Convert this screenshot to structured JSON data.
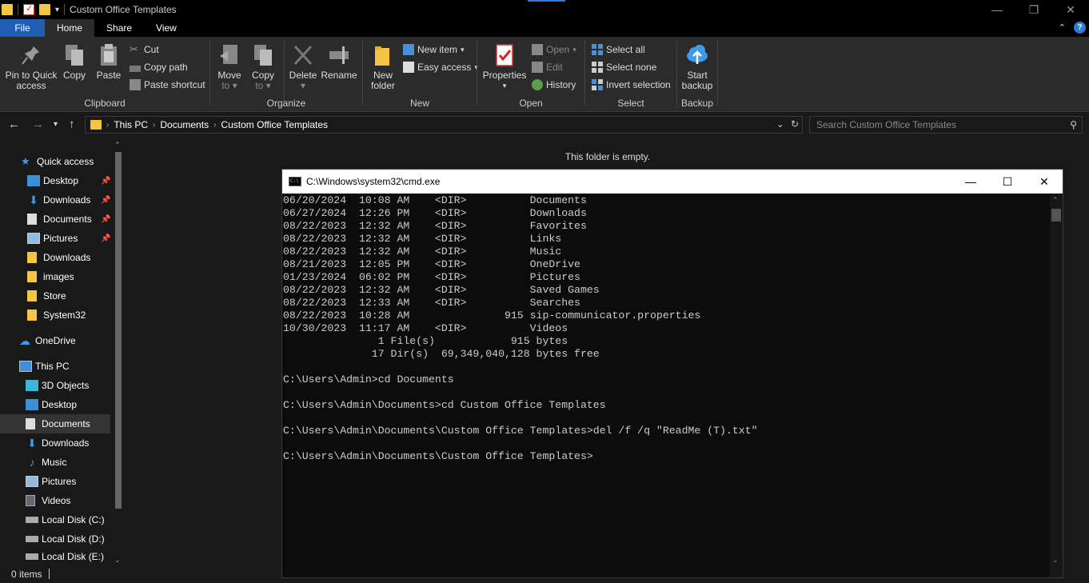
{
  "window": {
    "title": "Custom Office Templates"
  },
  "ribbon_tabs": [
    {
      "label": "File"
    },
    {
      "label": "Home"
    },
    {
      "label": "Share"
    },
    {
      "label": "View"
    }
  ],
  "ribbon": {
    "clipboard": {
      "label": "Clipboard",
      "pin": "Pin to Quick access",
      "pin_line1": "Pin to Quick",
      "pin_line2": "access",
      "copy": "Copy",
      "paste": "Paste",
      "cut": "Cut",
      "copy_path": "Copy path",
      "paste_shortcut": "Paste shortcut"
    },
    "organize": {
      "label": "Organize",
      "move_line1": "Move",
      "move_line2": "to",
      "copy_line1": "Copy",
      "copy_line2": "to",
      "delete": "Delete",
      "rename": "Rename"
    },
    "new": {
      "label": "New",
      "new_folder_line1": "New",
      "new_folder_line2": "folder",
      "new_item": "New item",
      "easy_access": "Easy access"
    },
    "open": {
      "label": "Open",
      "properties": "Properties",
      "open": "Open",
      "edit": "Edit",
      "history": "History"
    },
    "select": {
      "label": "Select",
      "select_all": "Select all",
      "select_none": "Select none",
      "invert": "Invert selection"
    },
    "backup": {
      "label": "Backup",
      "start_line1": "Start",
      "start_line2": "backup"
    }
  },
  "address": {
    "crumbs": [
      "This PC",
      "Documents",
      "Custom Office Templates"
    ],
    "search_placeholder": "Search Custom Office Templates"
  },
  "nav": {
    "quick_access": "Quick access",
    "quick_items": [
      {
        "label": "Desktop",
        "pinned": true,
        "icon": "desktop-icon"
      },
      {
        "label": "Downloads",
        "pinned": true,
        "icon": "downloads-icon"
      },
      {
        "label": "Documents",
        "pinned": true,
        "icon": "documents-icon"
      },
      {
        "label": "Pictures",
        "pinned": true,
        "icon": "pictures-icon"
      },
      {
        "label": "Downloads",
        "pinned": false,
        "icon": "folder-icon"
      },
      {
        "label": "images",
        "pinned": false,
        "icon": "folder-icon"
      },
      {
        "label": "Store",
        "pinned": false,
        "icon": "folder-icon"
      },
      {
        "label": "System32",
        "pinned": false,
        "icon": "folder-icon"
      }
    ],
    "onedrive": "OneDrive",
    "this_pc": "This PC",
    "pc_items": [
      {
        "label": "3D Objects",
        "icon": "3d-objects-icon"
      },
      {
        "label": "Desktop",
        "icon": "desktop-icon"
      },
      {
        "label": "Documents",
        "icon": "documents-icon",
        "selected": true
      },
      {
        "label": "Downloads",
        "icon": "downloads-icon"
      },
      {
        "label": "Music",
        "icon": "music-icon"
      },
      {
        "label": "Pictures",
        "icon": "pictures-icon"
      },
      {
        "label": "Videos",
        "icon": "videos-icon"
      },
      {
        "label": "Local Disk (C:)",
        "icon": "drive-icon"
      },
      {
        "label": "Local Disk (D:)",
        "icon": "drive-icon"
      },
      {
        "label": "Local Disk (E:)",
        "icon": "drive-icon"
      }
    ]
  },
  "content": {
    "empty_message": "This folder is empty."
  },
  "status": {
    "items": "0 items"
  },
  "cmd": {
    "title": "C:\\Windows\\system32\\cmd.exe",
    "lines": [
      "06/20/2024  10:08 AM    <DIR>          Documents",
      "06/27/2024  12:26 PM    <DIR>          Downloads",
      "08/22/2023  12:32 AM    <DIR>          Favorites",
      "08/22/2023  12:32 AM    <DIR>          Links",
      "08/22/2023  12:32 AM    <DIR>          Music",
      "08/21/2023  12:05 PM    <DIR>          OneDrive",
      "01/23/2024  06:02 PM    <DIR>          Pictures",
      "08/22/2023  12:32 AM    <DIR>          Saved Games",
      "08/22/2023  12:33 AM    <DIR>          Searches",
      "08/22/2023  10:28 AM               915 sip-communicator.properties",
      "10/30/2023  11:17 AM    <DIR>          Videos",
      "               1 File(s)            915 bytes",
      "              17 Dir(s)  69,349,040,128 bytes free",
      "",
      "C:\\Users\\Admin>cd Documents",
      "",
      "C:\\Users\\Admin\\Documents>cd Custom Office Templates",
      "",
      "C:\\Users\\Admin\\Documents\\Custom Office Templates>del /f /q \"ReadMe (T).txt\"",
      "",
      "C:\\Users\\Admin\\Documents\\Custom Office Templates>"
    ]
  }
}
